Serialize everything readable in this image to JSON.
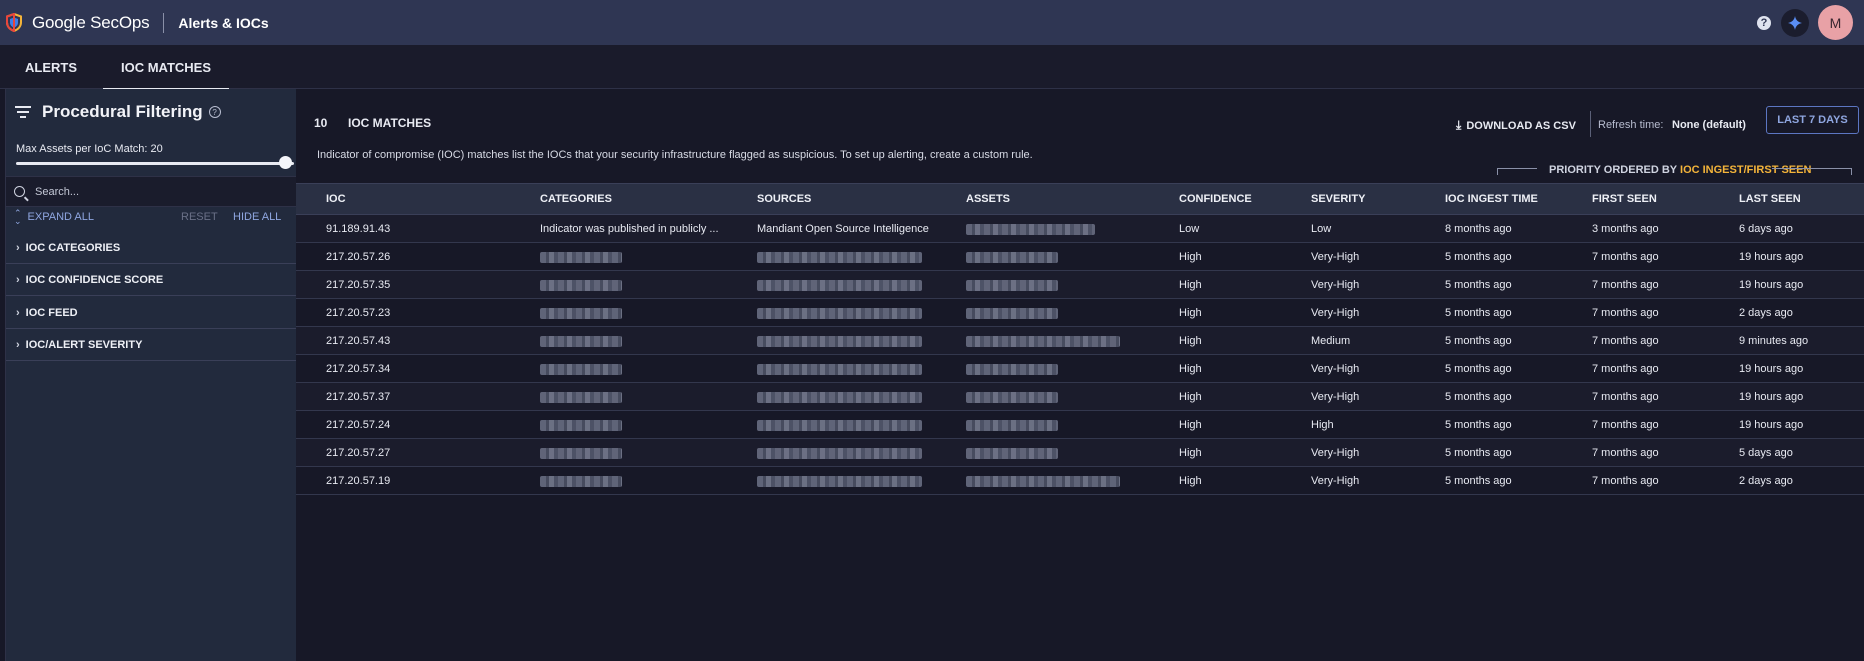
{
  "app": {
    "brand": "Google SecOps",
    "page": "Alerts & IOCs",
    "avatar_initial": "M",
    "help_glyph": "?",
    "accent_color": "#f4b43a",
    "link_color": "#8fa6e0"
  },
  "tabs": [
    {
      "label": "ALERTS",
      "active": false
    },
    {
      "label": "IOC MATCHES",
      "active": true
    }
  ],
  "sidebar": {
    "title": "Procedural Filtering",
    "max_assets_label": "Max Assets per IoC Match: 20",
    "max_assets_value": 20,
    "search_placeholder": "Search...",
    "expand_all": "EXPAND ALL",
    "reset": "RESET",
    "hide_all": "HIDE ALL",
    "groups": [
      {
        "label": "IOC CATEGORIES"
      },
      {
        "label": "IOC CONFIDENCE SCORE"
      },
      {
        "label": "IOC FEED"
      },
      {
        "label": "IOC/ALERT SEVERITY"
      }
    ]
  },
  "main": {
    "count": "10",
    "title": "IOC MATCHES",
    "description": "Indicator of compromise (IOC) matches list the IOCs that your security infrastructure flagged as suspicious. To set up alerting, create a custom rule.",
    "download_label": "DOWNLOAD AS CSV",
    "refresh_label": "Refresh time:",
    "refresh_value": "None (default)",
    "range_button": "LAST 7 DAYS",
    "priority_prefix": "PRIORITY ORDERED BY ",
    "priority_field": "IOC INGEST/FIRST SEEN"
  },
  "table": {
    "columns": [
      "IOC",
      "CATEGORIES",
      "SOURCES",
      "ASSETS",
      "CONFIDENCE",
      "SEVERITY",
      "IOC INGEST TIME",
      "FIRST SEEN",
      "LAST SEEN"
    ],
    "rows": [
      {
        "ioc": "91.189.91.43",
        "category": "Indicator was published in publicly ...",
        "source": "Mandiant Open Source Intelligence",
        "confidence": "Low",
        "severity": "Low",
        "ingest": "8 months ago",
        "first_seen": "3 months ago",
        "last_seen": "6 days ago"
      },
      {
        "ioc": "217.20.57.26",
        "category": "",
        "source": "",
        "confidence": "High",
        "severity": "Very-High",
        "ingest": "5 months ago",
        "first_seen": "7 months ago",
        "last_seen": "19 hours ago"
      },
      {
        "ioc": "217.20.57.35",
        "category": "",
        "source": "",
        "confidence": "High",
        "severity": "Very-High",
        "ingest": "5 months ago",
        "first_seen": "7 months ago",
        "last_seen": "19 hours ago"
      },
      {
        "ioc": "217.20.57.23",
        "category": "",
        "source": "",
        "confidence": "High",
        "severity": "Very-High",
        "ingest": "5 months ago",
        "first_seen": "7 months ago",
        "last_seen": "2 days ago"
      },
      {
        "ioc": "217.20.57.43",
        "category": "",
        "source": "",
        "confidence": "High",
        "severity": "Medium",
        "ingest": "5 months ago",
        "first_seen": "7 months ago",
        "last_seen": "9 minutes ago"
      },
      {
        "ioc": "217.20.57.34",
        "category": "",
        "source": "",
        "confidence": "High",
        "severity": "Very-High",
        "ingest": "5 months ago",
        "first_seen": "7 months ago",
        "last_seen": "19 hours ago"
      },
      {
        "ioc": "217.20.57.37",
        "category": "",
        "source": "",
        "confidence": "High",
        "severity": "Very-High",
        "ingest": "5 months ago",
        "first_seen": "7 months ago",
        "last_seen": "19 hours ago"
      },
      {
        "ioc": "217.20.57.24",
        "category": "",
        "source": "",
        "confidence": "High",
        "severity": "High",
        "ingest": "5 months ago",
        "first_seen": "7 months ago",
        "last_seen": "19 hours ago"
      },
      {
        "ioc": "217.20.57.27",
        "category": "",
        "source": "",
        "confidence": "High",
        "severity": "Very-High",
        "ingest": "5 months ago",
        "first_seen": "7 months ago",
        "last_seen": "5 days ago"
      },
      {
        "ioc": "217.20.57.19",
        "category": "",
        "source": "",
        "confidence": "High",
        "severity": "Very-High",
        "ingest": "5 months ago",
        "first_seen": "7 months ago",
        "last_seen": "2 days ago"
      }
    ]
  }
}
